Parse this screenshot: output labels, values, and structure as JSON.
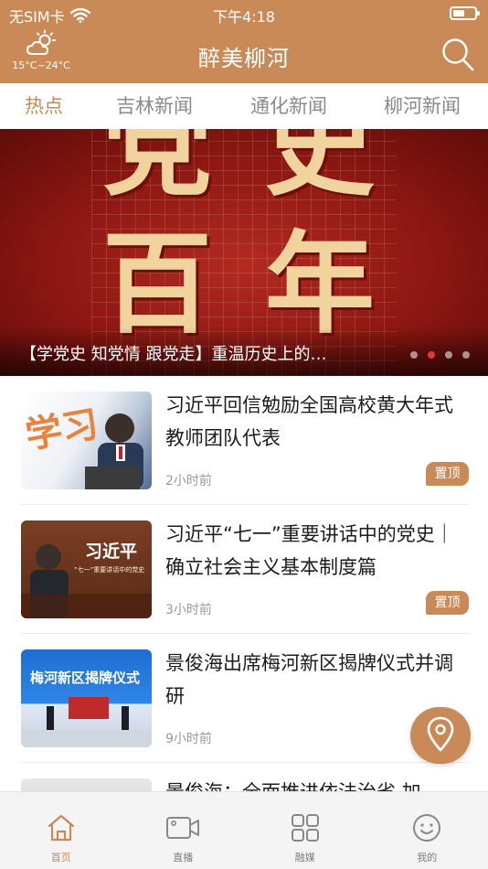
{
  "status_bar": {
    "carrier": "无SIM卡",
    "time": "下午4:18",
    "battery_level": 0.55
  },
  "header": {
    "title": "醉美柳河",
    "weather_temp": "15°C~24°C",
    "weather_icon": "partly-cloudy-icon",
    "search_icon": "search-icon"
  },
  "tabs": [
    {
      "label": "热点",
      "active": true
    },
    {
      "label": "吉林新闻",
      "active": false
    },
    {
      "label": "通化新闻",
      "active": false
    },
    {
      "label": "柳河新闻",
      "active": false
    }
  ],
  "banner": {
    "caption": "【学党史 知党情 跟党走】重温历史上的…",
    "image_text": [
      "党",
      "史",
      "百",
      "年"
    ],
    "dot_count": 4,
    "active_dot": 1
  },
  "news": [
    {
      "title": "习近平回信勉励全国高校黄大年式教师团队代表",
      "time": "2小时前",
      "badge": "置顶",
      "thumb_text": "学习"
    },
    {
      "title": "习近平“七一”重要讲话中的党史｜确立社会主义基本制度篇",
      "time": "3小时前",
      "badge": "置顶",
      "thumb_text": "习近平",
      "thumb_sub": "“七一”重要讲话中的党史"
    },
    {
      "title": "景俊海出席梅河新区揭牌仪式并调研",
      "time": "9小时前",
      "badge": "",
      "thumb_text": "梅河新区揭牌仪式"
    },
    {
      "title": "景俊海：全面推进依法治省 加",
      "time": "",
      "badge": ""
    }
  ],
  "bottom_nav": [
    {
      "label": "首页",
      "icon": "home-icon",
      "active": true
    },
    {
      "label": "直播",
      "icon": "video-camera-icon",
      "active": false
    },
    {
      "label": "融媒",
      "icon": "grid-icon",
      "active": false
    },
    {
      "label": "我的",
      "icon": "smiley-icon",
      "active": false
    }
  ],
  "colors": {
    "accent": "#c98a57",
    "badge_dot": "#e0353a"
  }
}
